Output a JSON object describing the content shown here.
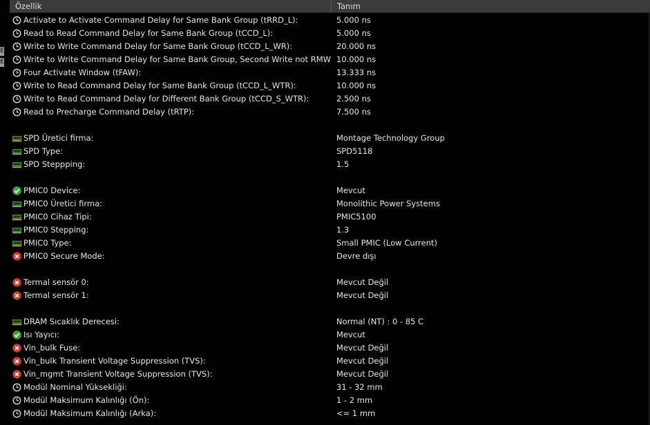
{
  "header": {
    "col_property": "Özellik",
    "col_value": "Tanım"
  },
  "left_strip": [
    "E",
    "E"
  ],
  "rows": [
    {
      "icon": "clock",
      "label": "Activate to Activate Command Delay for Same Bank Group (tRRD_L):",
      "value": "5.000 ns"
    },
    {
      "icon": "clock",
      "label": "Read to Read Command Delay for Same Bank Group (tCCD_L):",
      "value": "5.000 ns"
    },
    {
      "icon": "clock",
      "label": "Write to Write Command Delay for Same Bank Group (tCCD_L_WR):",
      "value": "20.000 ns"
    },
    {
      "icon": "clock",
      "label": "Write to Write Command Delay for Same Bank Group, Second Write not RMW...",
      "value": "10.000 ns"
    },
    {
      "icon": "clock",
      "label": "Four Activate Window (tFAW):",
      "value": "13.333 ns"
    },
    {
      "icon": "clock",
      "label": "Write to Read Command Delay for Same Bank Group (tCCD_L_WTR):",
      "value": "10.000 ns"
    },
    {
      "icon": "clock",
      "label": "Write to Read Command Delay for Different Bank Group (tCCD_S_WTR):",
      "value": "2.500 ns"
    },
    {
      "icon": "clock",
      "label": "Read to Precharge Command Delay (tRTP):",
      "value": "7.500 ns"
    },
    {
      "icon": "",
      "label": "",
      "value": ""
    },
    {
      "icon": "memory",
      "label": "SPD Üretici firma:",
      "value": "Montage Technology Group"
    },
    {
      "icon": "memory",
      "label": "SPD Type:",
      "value": "SPD5118"
    },
    {
      "icon": "memory",
      "label": "SPD Steppping:",
      "value": "1.5"
    },
    {
      "icon": "",
      "label": "",
      "value": ""
    },
    {
      "icon": "check",
      "label": "PMIC0 Device:",
      "value": "Mevcut"
    },
    {
      "icon": "memory",
      "label": "PMIC0 Üretici firma:",
      "value": "Monolithic Power Systems"
    },
    {
      "icon": "memory",
      "label": "PMIC0 Cihaz Tipi:",
      "value": "PMIC5100"
    },
    {
      "icon": "memory",
      "label": "PMIC0 Stepping:",
      "value": "1.3"
    },
    {
      "icon": "memory",
      "label": "PMIC0 Type:",
      "value": "Small PMIC (Low Current)"
    },
    {
      "icon": "cross",
      "label": "PMIC0 Secure Mode:",
      "value": "Devre dışı"
    },
    {
      "icon": "",
      "label": "",
      "value": ""
    },
    {
      "icon": "cross",
      "label": "Termal sensör 0:",
      "value": "Mevcut Değil"
    },
    {
      "icon": "cross",
      "label": "Termal sensör 1:",
      "value": "Mevcut Değil"
    },
    {
      "icon": "",
      "label": "",
      "value": ""
    },
    {
      "icon": "memory",
      "label": "DRAM Sıcaklık Derecesi:",
      "value": "Normal (NT) : 0 - 85 C"
    },
    {
      "icon": "check",
      "label": "Isı Yayıcı:",
      "value": "Mevcut"
    },
    {
      "icon": "cross",
      "label": "Vin_bulk Fuse:",
      "value": "Mevcut Değil"
    },
    {
      "icon": "cross",
      "label": "Vin_bulk Transient Voltage Suppression (TVS):",
      "value": "Mevcut Değil"
    },
    {
      "icon": "cross",
      "label": "Vin_mgmt Transient Voltage Suppression (TVS):",
      "value": "Mevcut Değil"
    },
    {
      "icon": "clock",
      "label": "Modül Nominal Yüksekliği:",
      "value": "31 - 32 mm"
    },
    {
      "icon": "clock",
      "label": "Modül Maksimum Kalınlığı (Ön):",
      "value": "1 - 2 mm"
    },
    {
      "icon": "clock",
      "label": "Modül Maksimum Kalınlığı (Arka):",
      "value": "<= 1 mm"
    }
  ]
}
